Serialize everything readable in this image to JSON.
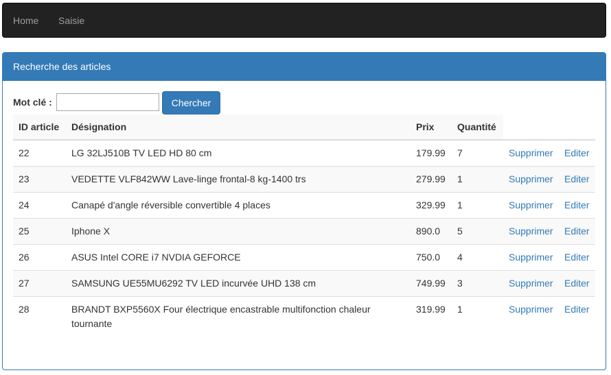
{
  "navbar": {
    "home_label": "Home",
    "saisie_label": "Saisie"
  },
  "panel": {
    "heading": "Recherche des articles"
  },
  "search": {
    "label": "Mot clé :",
    "value": "",
    "placeholder": "",
    "button_label": "Chercher"
  },
  "table": {
    "headers": {
      "id": "ID article",
      "designation": "Désignation",
      "prix": "Prix",
      "quantite": "Quantité"
    },
    "delete_label": "Supprimer",
    "edit_label": "Editer",
    "rows": [
      {
        "id": "22",
        "designation": "LG 32LJ510B TV LED HD 80 cm",
        "prix": "179.99",
        "quantite": "7"
      },
      {
        "id": "23",
        "designation": "VEDETTE VLF842WW Lave-linge frontal-8 kg-1400 trs",
        "prix": "279.99",
        "quantite": "1"
      },
      {
        "id": "24",
        "designation": "Canapé d'angle réversible convertible 4 places",
        "prix": "329.99",
        "quantite": "1"
      },
      {
        "id": "25",
        "designation": "Iphone X",
        "prix": "890.0",
        "quantite": "5"
      },
      {
        "id": "26",
        "designation": "ASUS Intel CORE i7 NVDIA GEFORCE",
        "prix": "750.0",
        "quantite": "4"
      },
      {
        "id": "27",
        "designation": "SAMSUNG UE55MU6292 TV LED incurvée UHD 138 cm",
        "prix": "749.99",
        "quantite": "3"
      },
      {
        "id": "28",
        "designation": "BRANDT BXP5560X Four électrique encastrable multifonction chaleur tournante",
        "prix": "319.99",
        "quantite": "1"
      }
    ]
  },
  "colors": {
    "navbar_bg": "#222222",
    "nav_text": "#9d9d9d",
    "primary": "#337ab7",
    "stripe": "#f9f9f9",
    "border": "#dddddd"
  }
}
